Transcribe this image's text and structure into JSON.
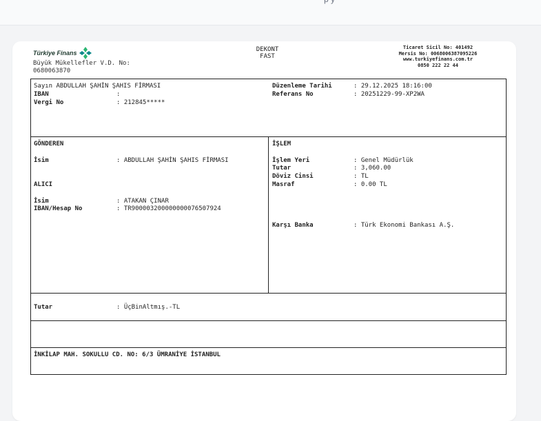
{
  "top_partial_text": "p  y ",
  "header": {
    "logo_name": "Türkiye Finans",
    "office_line1": "Büyük Mükellefler V.D. No:",
    "office_line2": "0680063870",
    "doc_title": "DEKONT",
    "doc_subtitle": "FAST",
    "registry": "Ticaret Sicil No: 401492",
    "mersis": "Mersis No: 0068006387095226",
    "website": "www.turkiyefinans.com.tr",
    "phone": "0850 222 22 44"
  },
  "customer": {
    "greeting": "Sayın ABDULLAH ŞAHİN ŞAHIS FİRMASI",
    "iban_label": "IBAN",
    "iban_value": ":",
    "tax_label": "Vergi No",
    "tax_value": ": 212845*****",
    "date_label": "Düzenleme Tarihi",
    "date_value": ": 29.12.2025 18:16:00",
    "ref_label": "Referans No",
    "ref_value": ": 20251229-99-XP2WA"
  },
  "sender": {
    "section_title": "GÖNDEREN",
    "name_label": "İsim",
    "name_value": ": ABDULLAH ŞAHİN ŞAHIS FİRMASI"
  },
  "receiver": {
    "section_title": "ALICI",
    "name_label": "İsim",
    "name_value": ": ATAKAN ÇINAR",
    "iban_label": "IBAN/Hesap No",
    "iban_value": ": TR900003200000000076507924"
  },
  "transaction": {
    "section_title": "İŞLEM",
    "place_label": "İşlem Yeri",
    "place_value": ": Genel Müdürlük",
    "amount_label": "Tutar",
    "amount_value": ": 3,060.00",
    "currency_label": "Döviz Cinsi",
    "currency_value": ": TL",
    "fee_label": "Masraf",
    "fee_value": ": 0.00 TL",
    "bank_label": "Karşı Banka",
    "bank_value": ": Türk Ekonomi Bankası A.Ş."
  },
  "total": {
    "label": "Tutar",
    "value": ": ÜçBinAltmış.-TL"
  },
  "footer": {
    "address": "İNKİLAP MAH. SOKULLU CD. NO: 6/3 ÜMRANİYE İSTANBUL"
  },
  "colors": {
    "logo_green": "#2bb673",
    "logo_teal": "#0f8a8a",
    "border": "#222222"
  }
}
